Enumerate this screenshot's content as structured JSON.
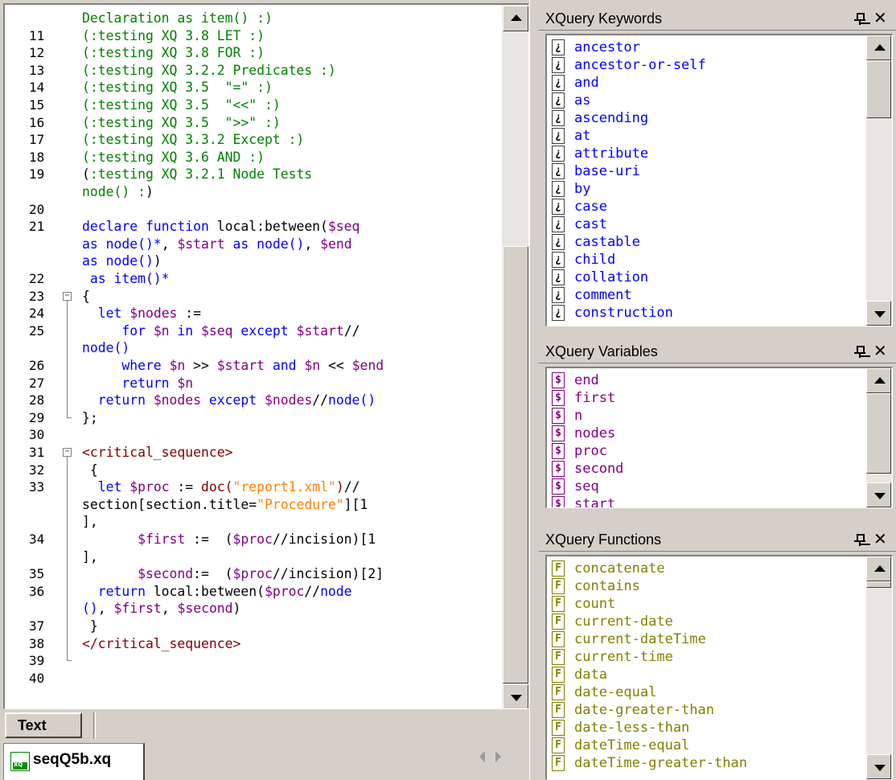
{
  "editor": {
    "lines": [
      {
        "num": "",
        "parts": [
          {
            "c": "g",
            "t": "Declaration as item() :)"
          }
        ]
      },
      {
        "num": "11",
        "parts": [
          {
            "c": "g",
            "t": "(:testing XQ 3.8 LET :)"
          }
        ]
      },
      {
        "num": "12",
        "parts": [
          {
            "c": "g",
            "t": "(:testing XQ 3.8 FOR :)"
          }
        ]
      },
      {
        "num": "13",
        "parts": [
          {
            "c": "g",
            "t": "(:testing XQ 3.2.2 Predicates :)"
          }
        ]
      },
      {
        "num": "14",
        "parts": [
          {
            "c": "g",
            "t": "(:testing XQ 3.5  \"=\" :)"
          }
        ]
      },
      {
        "num": "15",
        "parts": [
          {
            "c": "g",
            "t": "(:testing XQ 3.5  \"<<\" :)"
          }
        ]
      },
      {
        "num": "16",
        "parts": [
          {
            "c": "g",
            "t": "(:testing XQ 3.5  \">>\" :)"
          }
        ]
      },
      {
        "num": "17",
        "parts": [
          {
            "c": "g",
            "t": "(:testing XQ 3.3.2 Except :)"
          }
        ]
      },
      {
        "num": "18",
        "parts": [
          {
            "c": "g",
            "t": "(:testing XQ 3.6 AND :)"
          }
        ]
      },
      {
        "num": "19",
        "parts": [
          {
            "c": "k",
            "t": "("
          },
          {
            "c": "g",
            "t": ":testing XQ 3.2.1 Node Tests"
          }
        ]
      },
      {
        "num": "",
        "parts": [
          {
            "c": "g",
            "t": "node() :"
          },
          {
            "c": "k",
            "t": ")"
          }
        ]
      },
      {
        "num": "20",
        "parts": []
      },
      {
        "num": "21",
        "parts": [
          {
            "c": "b",
            "t": "declare function "
          },
          {
            "c": "k",
            "t": "local:between("
          },
          {
            "c": "v",
            "t": "$seq"
          }
        ]
      },
      {
        "num": "",
        "parts": [
          {
            "c": "b",
            "t": "as node()*"
          },
          {
            "c": "k",
            "t": ", "
          },
          {
            "c": "v",
            "t": "$start"
          },
          {
            "c": "b",
            "t": " as node()"
          },
          {
            "c": "k",
            "t": ", "
          },
          {
            "c": "v",
            "t": "$end"
          }
        ]
      },
      {
        "num": "",
        "parts": [
          {
            "c": "b",
            "t": "as node()"
          },
          {
            "c": "k",
            "t": ")"
          }
        ]
      },
      {
        "num": "22",
        "parts": [
          {
            "c": "b",
            "t": " as item()*"
          }
        ]
      },
      {
        "num": "23",
        "parts": [
          {
            "c": "k",
            "t": "{"
          }
        ]
      },
      {
        "num": "24",
        "parts": [
          {
            "c": "b",
            "t": "  let "
          },
          {
            "c": "v",
            "t": "$nodes"
          },
          {
            "c": "k",
            "t": " :="
          }
        ]
      },
      {
        "num": "25",
        "parts": [
          {
            "c": "b",
            "t": "     for "
          },
          {
            "c": "v",
            "t": "$n"
          },
          {
            "c": "b",
            "t": " in "
          },
          {
            "c": "v",
            "t": "$seq"
          },
          {
            "c": "b",
            "t": " except "
          },
          {
            "c": "v",
            "t": "$start"
          },
          {
            "c": "k",
            "t": "//"
          }
        ]
      },
      {
        "num": "",
        "parts": [
          {
            "c": "b",
            "t": "node()"
          }
        ]
      },
      {
        "num": "26",
        "parts": [
          {
            "c": "b",
            "t": "     where "
          },
          {
            "c": "v",
            "t": "$n"
          },
          {
            "c": "k",
            "t": " >> "
          },
          {
            "c": "v",
            "t": "$start"
          },
          {
            "c": "b",
            "t": " and "
          },
          {
            "c": "v",
            "t": "$n"
          },
          {
            "c": "k",
            "t": " << "
          },
          {
            "c": "v",
            "t": "$end"
          }
        ]
      },
      {
        "num": "27",
        "parts": [
          {
            "c": "b",
            "t": "     return "
          },
          {
            "c": "v",
            "t": "$n"
          }
        ]
      },
      {
        "num": "28",
        "parts": [
          {
            "c": "b",
            "t": "  return "
          },
          {
            "c": "v",
            "t": "$nodes"
          },
          {
            "c": "b",
            "t": " except "
          },
          {
            "c": "v",
            "t": "$nodes"
          },
          {
            "c": "k",
            "t": "//"
          },
          {
            "c": "b",
            "t": "node()"
          }
        ]
      },
      {
        "num": "29",
        "parts": [
          {
            "c": "k",
            "t": "};"
          }
        ]
      },
      {
        "num": "30",
        "parts": []
      },
      {
        "num": "31",
        "parts": [
          {
            "c": "m",
            "t": "<critical_sequence>"
          }
        ]
      },
      {
        "num": "32",
        "parts": [
          {
            "c": "k",
            "t": " {"
          }
        ]
      },
      {
        "num": "33",
        "parts": [
          {
            "c": "b",
            "t": "  let "
          },
          {
            "c": "v",
            "t": "$proc"
          },
          {
            "c": "k",
            "t": " := "
          },
          {
            "c": "m",
            "t": "doc("
          },
          {
            "c": "o",
            "t": "\"report1.xml\""
          },
          {
            "c": "m",
            "t": ")"
          },
          {
            "c": "k",
            "t": "//"
          }
        ]
      },
      {
        "num": "",
        "parts": [
          {
            "c": "k",
            "t": "section[section.title="
          },
          {
            "c": "o",
            "t": "\"Procedure\""
          },
          {
            "c": "k",
            "t": "][1"
          }
        ]
      },
      {
        "num": "",
        "parts": [
          {
            "c": "k",
            "t": "],"
          }
        ]
      },
      {
        "num": "34",
        "parts": [
          {
            "c": "k",
            "t": "       "
          },
          {
            "c": "v",
            "t": "$first"
          },
          {
            "c": "k",
            "t": " :=  ("
          },
          {
            "c": "v",
            "t": "$proc"
          },
          {
            "c": "k",
            "t": "//incision)[1"
          }
        ]
      },
      {
        "num": "",
        "parts": [
          {
            "c": "k",
            "t": "],"
          }
        ]
      },
      {
        "num": "35",
        "parts": [
          {
            "c": "k",
            "t": "       "
          },
          {
            "c": "v",
            "t": "$second"
          },
          {
            "c": "k",
            "t": ":=  ("
          },
          {
            "c": "v",
            "t": "$proc"
          },
          {
            "c": "k",
            "t": "//incision)[2]"
          }
        ]
      },
      {
        "num": "36",
        "parts": [
          {
            "c": "b",
            "t": "  return "
          },
          {
            "c": "k",
            "t": "local:between("
          },
          {
            "c": "v",
            "t": "$proc"
          },
          {
            "c": "k",
            "t": "//"
          },
          {
            "c": "b",
            "t": "node"
          }
        ]
      },
      {
        "num": "",
        "parts": [
          {
            "c": "b",
            "t": "()"
          },
          {
            "c": "k",
            "t": ", "
          },
          {
            "c": "v",
            "t": "$first"
          },
          {
            "c": "k",
            "t": ", "
          },
          {
            "c": "v",
            "t": "$second"
          },
          {
            "c": "k",
            "t": ")"
          }
        ]
      },
      {
        "num": "37",
        "parts": [
          {
            "c": "k",
            "t": " }"
          }
        ]
      },
      {
        "num": "38",
        "parts": [
          {
            "c": "m",
            "t": "</critical_sequence>"
          }
        ]
      },
      {
        "num": "39",
        "parts": []
      },
      {
        "num": "40",
        "parts": []
      }
    ],
    "view_tab": "Text",
    "file_tab": "seqQ5b.xq",
    "file_icon": "xq-file-icon"
  },
  "panels": {
    "keywords": {
      "title": "XQuery Keywords",
      "icon_glyph": "¿",
      "items": [
        "ancestor",
        "ancestor-or-self",
        "and",
        "as",
        "ascending",
        "at",
        "attribute",
        "base-uri",
        "by",
        "case",
        "cast",
        "castable",
        "child",
        "collation",
        "comment",
        "construction"
      ]
    },
    "variables": {
      "title": "XQuery Variables",
      "icon_glyph": "$",
      "items": [
        "end",
        "first",
        "n",
        "nodes",
        "proc",
        "second",
        "seq",
        "start"
      ]
    },
    "functions": {
      "title": "XQuery Functions",
      "icon_glyph": "F",
      "items": [
        "concatenate",
        "contains",
        "count",
        "current-date",
        "current-dateTime",
        "current-time",
        "data",
        "date-equal",
        "date-greater-than",
        "date-less-than",
        "dateTime-equal",
        "dateTime-greater-than"
      ]
    },
    "pin_icon": "pin-icon",
    "close_glyph": "✕"
  },
  "colors": {
    "comment": "#008000",
    "keyword": "#0000ff",
    "variable": "#800080",
    "string": "#ff8000",
    "element": "#800000",
    "function_item": "#808000"
  }
}
